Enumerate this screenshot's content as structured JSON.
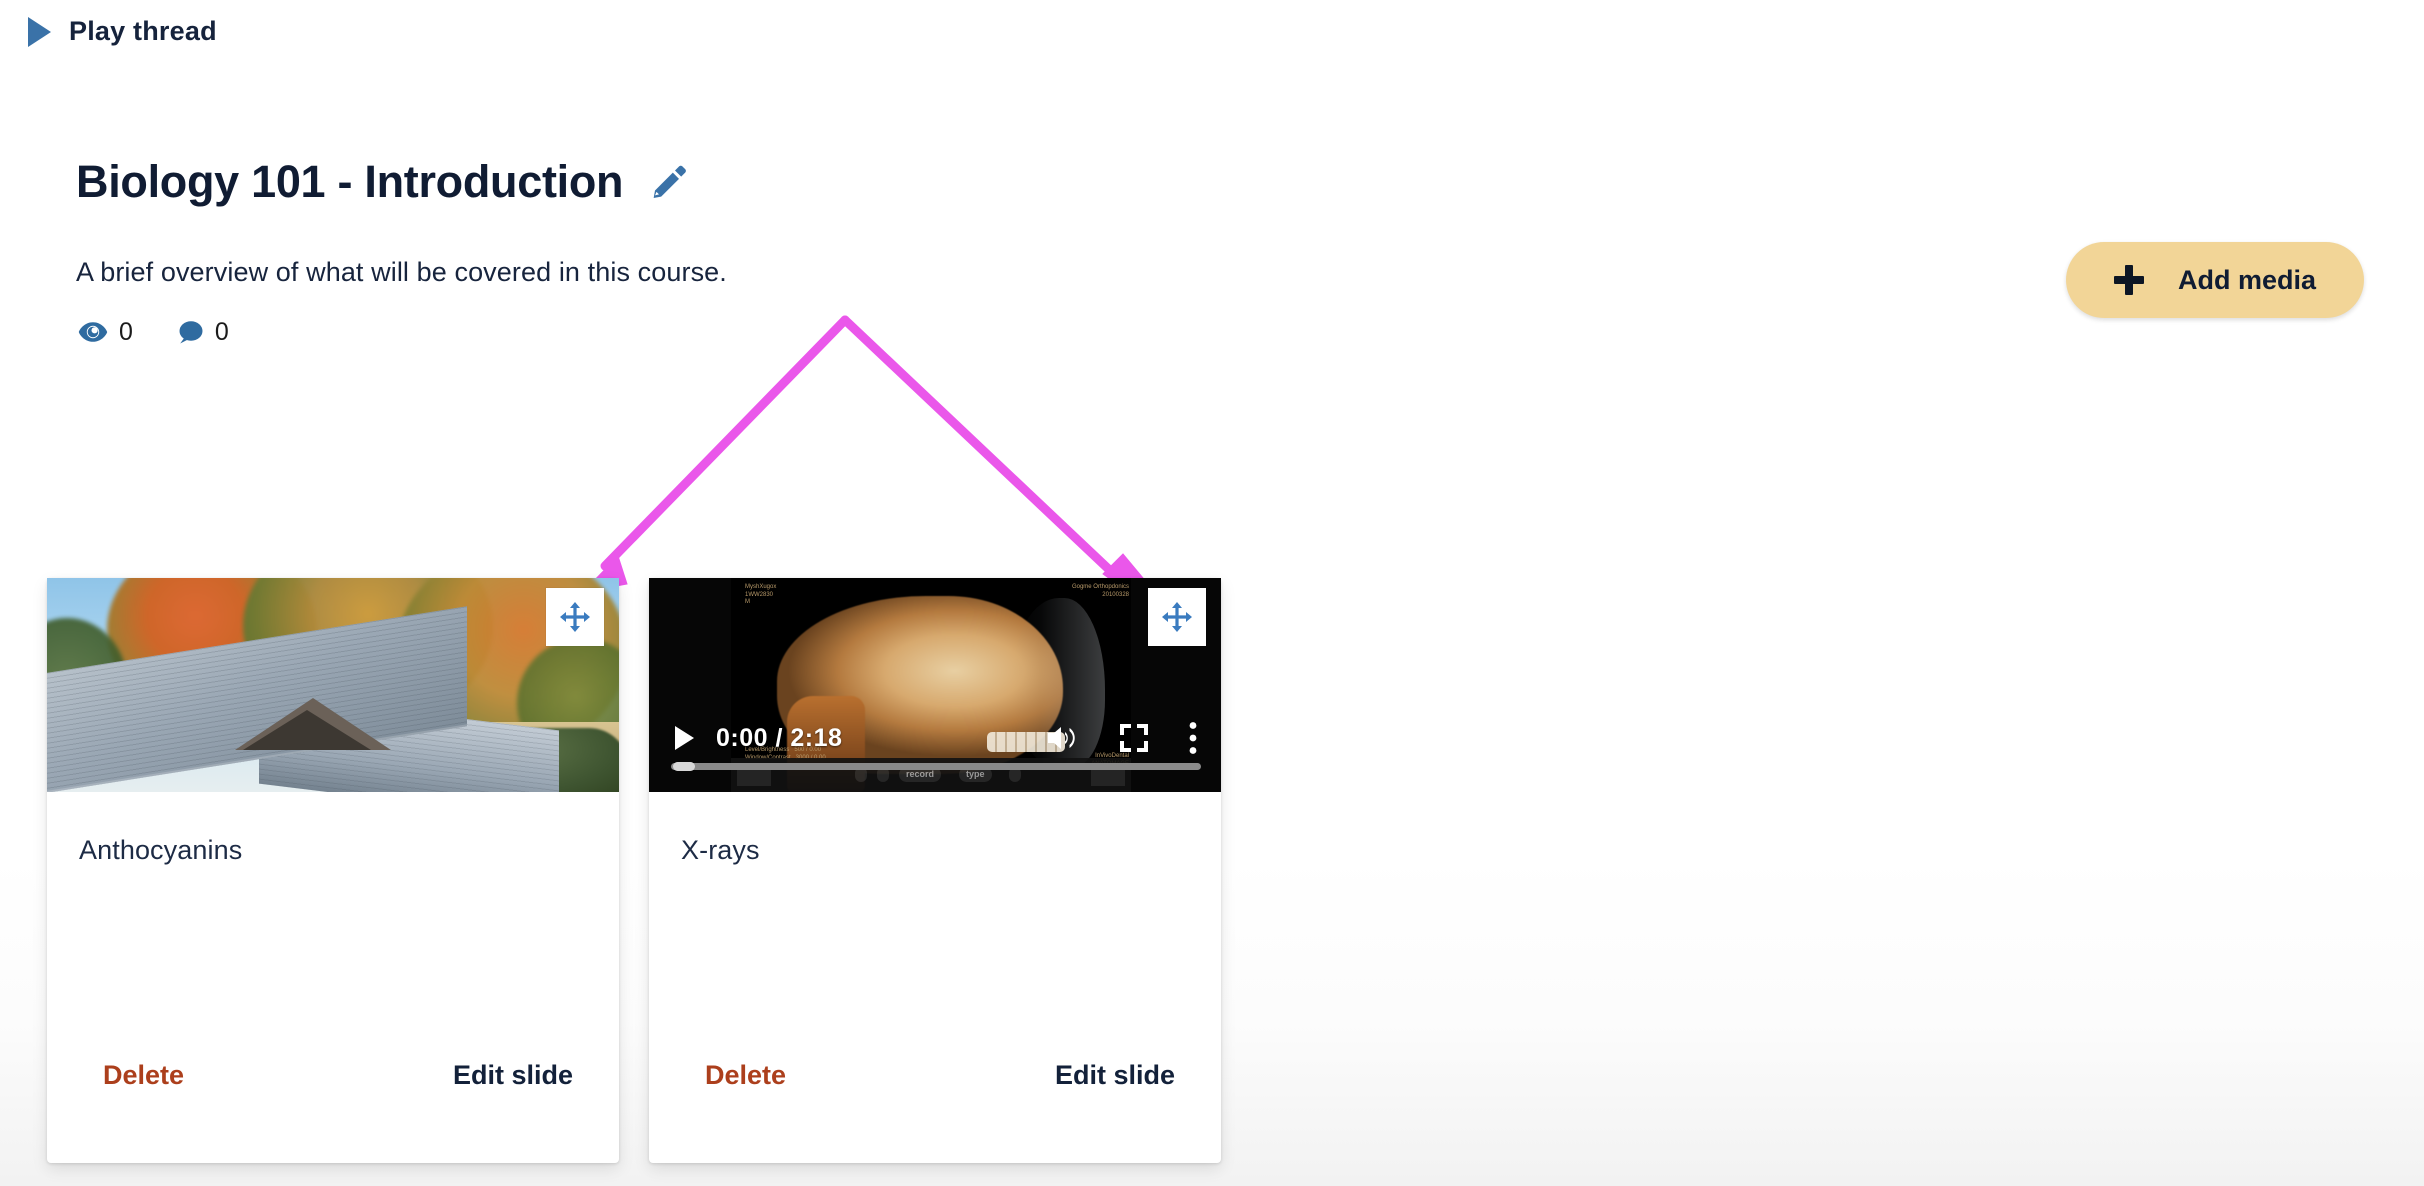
{
  "header": {
    "play_thread_label": "Play thread",
    "play_icon": "play-triangle-icon"
  },
  "thread": {
    "title": "Biology 101 - Introduction",
    "edit_icon": "pencil-icon",
    "description": "A brief overview of what will be covered in this course.",
    "stats": {
      "views_icon": "eye-icon",
      "views_count": "0",
      "comments_icon": "comment-bubble-icon",
      "comments_count": "0"
    }
  },
  "toolbar": {
    "add_media_label": "Add media",
    "add_media_icon": "plus-icon",
    "add_media_bg": "#f2d597"
  },
  "annotations": {
    "arrow_color": "#ea57ea",
    "count": 2,
    "description": "two magenta arrows pointing from a common apex down to each slide drag handle"
  },
  "slides": [
    {
      "media_type": "image",
      "media_alt": "autumn-tree-and-roof-photo",
      "drag_handle_icon": "move-arrows-icon",
      "title": "Anthocyanins",
      "delete_label": "Delete",
      "edit_label": "Edit slide"
    },
    {
      "media_type": "video",
      "media_alt": "medical-ct-scan-of-skull-video",
      "drag_handle_icon": "move-arrows-icon",
      "title": "X-rays",
      "delete_label": "Delete",
      "edit_label": "Edit slide",
      "video_controls": {
        "play_icon": "play-icon",
        "time_display": "0:00 / 2:18",
        "volume_icon": "volume-high-icon",
        "fullscreen_icon": "fullscreen-icon",
        "more_icon": "more-vertical-icon"
      },
      "video_overlay_text": {
        "top_left": "MyshXugox\n1WW2830\nM",
        "top_right": "Gogme Orthopdonics\n20100328",
        "bottom_left": "Level/Brightness   500 / 0.00\nWindow/Contrast   3000 / 0.00",
        "bottom_right": "InVivoDental\nANATOMAGE",
        "strip_record": "record",
        "strip_type": "type"
      }
    }
  ],
  "colors": {
    "accent_blue": "#3a72a8",
    "text_dark": "#16233c",
    "delete_red": "#ac3f1c",
    "button_gold": "#f2d597"
  }
}
